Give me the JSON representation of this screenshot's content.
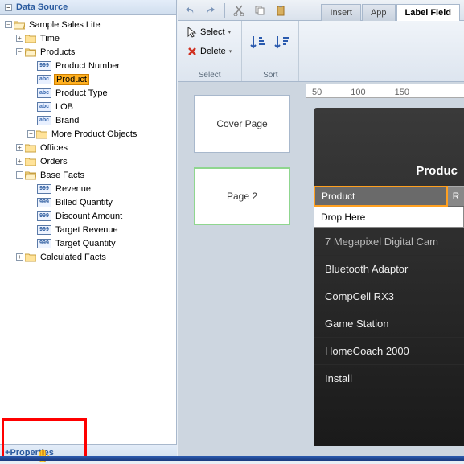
{
  "panels": {
    "data_source_title": "Data Source",
    "properties_title": "Properties"
  },
  "tree": {
    "root": "Sample Sales Lite",
    "time": "Time",
    "products": "Products",
    "product_number": "Product Number",
    "product": "Product",
    "product_type": "Product Type",
    "lob": "LOB",
    "brand": "Brand",
    "more_product_objects": "More Product Objects",
    "offices": "Offices",
    "orders": "Orders",
    "base_facts": "Base Facts",
    "revenue": "Revenue",
    "billed_quantity": "Billed Quantity",
    "discount_amount": "Discount Amount",
    "target_revenue": "Target Revenue",
    "target_quantity": "Target Quantity",
    "calculated_facts": "Calculated Facts"
  },
  "field_badges": {
    "num": "999",
    "abc": "abc"
  },
  "tabs": {
    "insert": "Insert",
    "app": "App",
    "label_field": "Label Field"
  },
  "ribbon": {
    "select_group": "Select",
    "sort_group": "Sort",
    "select_btn": "Select",
    "delete_btn": "Delete"
  },
  "ruler": {
    "t50": "50",
    "t100": "100",
    "t150": "150"
  },
  "thumbs": {
    "cover": "Cover Page",
    "page2": "Page 2"
  },
  "preview": {
    "title": "Produc",
    "col1": "Product",
    "col2": "R",
    "drop": "Drop Here",
    "rows": [
      "7 Megapixel Digital Cam",
      "Bluetooth Adaptor",
      "CompCell RX3",
      "Game Station",
      "HomeCoach 2000",
      "Install"
    ]
  }
}
